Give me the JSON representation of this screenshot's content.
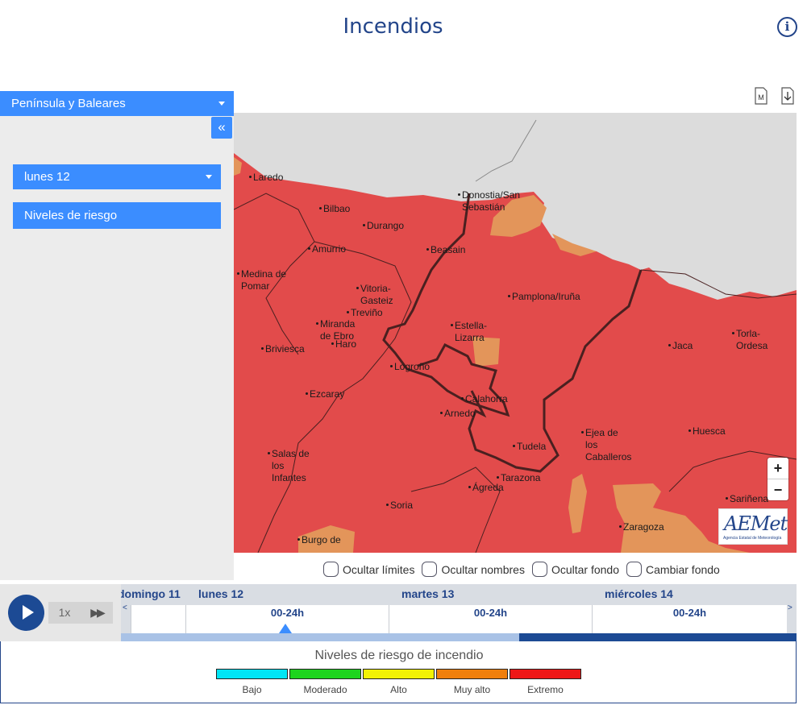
{
  "header": {
    "title": "Incendios",
    "info_icon": "i"
  },
  "toolbar": {
    "icons": [
      "map-legend-icon",
      "download-icon"
    ],
    "map_icon_letter": "M"
  },
  "sidebar": {
    "region": "Península y Baleares",
    "collapse_label": "«",
    "day": "lunes 12",
    "levels_button": "Niveles de riesgo"
  },
  "map": {
    "colors": {
      "extreme": "#e24b4b",
      "very_high": "#e3955a",
      "sea": "#dcdcdc",
      "border": "#5a2a2a"
    },
    "places": [
      {
        "name": "Laredo"
      },
      {
        "name": "Bilbao"
      },
      {
        "name": "Durango"
      },
      {
        "name": "Donostia/San\nSebastián"
      },
      {
        "name": "Amurrio"
      },
      {
        "name": "Beasain"
      },
      {
        "name": "Medina de\nPomar"
      },
      {
        "name": "Vitoria-\nGasteiz"
      },
      {
        "name": "Treviño"
      },
      {
        "name": "Pamplona/Iruña"
      },
      {
        "name": "Miranda\nde Ebro"
      },
      {
        "name": "Haro"
      },
      {
        "name": "Briviesca"
      },
      {
        "name": "Estella-\nLizarra"
      },
      {
        "name": "Logroño"
      },
      {
        "name": "Jaca"
      },
      {
        "name": "Torla-\nOrdesa"
      },
      {
        "name": "Ezcaray"
      },
      {
        "name": "Calahorra"
      },
      {
        "name": "Arnedo"
      },
      {
        "name": "Ejea de\nlos\nCaballeros"
      },
      {
        "name": "Huesca"
      },
      {
        "name": "Tudela"
      },
      {
        "name": "Salas de\nlos\nInfantes"
      },
      {
        "name": "Tarazona"
      },
      {
        "name": "Ágreda"
      },
      {
        "name": "Sariñena"
      },
      {
        "name": "Soria"
      },
      {
        "name": "Zaragoza"
      },
      {
        "name": "Burgo de"
      }
    ],
    "zoom_in": "+",
    "zoom_out": "−",
    "logo": {
      "text": "AEMet",
      "subtitle": "Agencia Estatal de Meteorología"
    }
  },
  "options": [
    {
      "label": "Ocultar límites"
    },
    {
      "label": "Ocultar nombres"
    },
    {
      "label": "Ocultar fondo"
    },
    {
      "label": "Cambiar fondo"
    }
  ],
  "player": {
    "speed": "1x",
    "fast_forward": "▶▶"
  },
  "timeline": {
    "days": [
      "domingo 11",
      "lunes 12",
      "martes 13",
      "miércoles 14"
    ],
    "slots": [
      "00-24h",
      "00-24h",
      "00-24h"
    ],
    "prev": "<",
    "next": ">",
    "progress": 0.59
  },
  "legend": {
    "title": "Niveles de riesgo de incendio",
    "levels": [
      {
        "label": "Bajo",
        "color": "#00e5f5"
      },
      {
        "label": "Moderado",
        "color": "#1ed41e"
      },
      {
        "label": "Alto",
        "color": "#f2f205"
      },
      {
        "label": "Muy alto",
        "color": "#f07f0c"
      },
      {
        "label": "Extremo",
        "color": "#ee1717"
      }
    ]
  }
}
